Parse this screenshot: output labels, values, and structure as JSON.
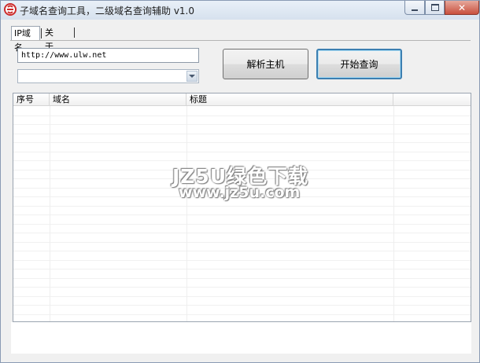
{
  "window": {
    "title": "子域名查询工具，二级域名查询辅助 v1.0",
    "close_glyph": "✕",
    "icon": "app-e-icon",
    "accent_color": "#cc2b2b"
  },
  "tabs": [
    {
      "label": "IP域名",
      "active": true
    },
    {
      "label": "关于",
      "active": false
    }
  ],
  "form": {
    "url_value": "http://www.ulw.net",
    "combo_value": ""
  },
  "buttons": {
    "resolve_label": "解析主机",
    "start_label": "开始查询"
  },
  "table": {
    "columns": [
      "序号",
      "域名",
      "标题",
      ""
    ],
    "rows": []
  },
  "watermark": {
    "line1": "JZ5U绿色下载",
    "line2": "www.jz5u.com"
  }
}
